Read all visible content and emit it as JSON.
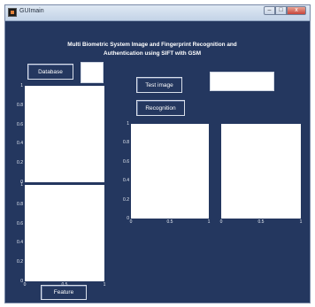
{
  "window": {
    "title": "GUImain"
  },
  "window_buttons": {
    "minimize": "–",
    "maximize": "□",
    "close": "x"
  },
  "heading": {
    "line1": "Multi Biometric System Image and Fingerprint Recognition and",
    "line2": "Authentication using SIFT with GSM"
  },
  "buttons": {
    "database": "Database",
    "test_image": "Test image",
    "recognition": "Recognition",
    "feature": "Feature"
  },
  "axes": {
    "left_top": {
      "yticks": [
        "1",
        "0.8",
        "0.6",
        "0.4",
        "0.2",
        "0"
      ],
      "xticks": []
    },
    "left_bottom": {
      "yticks": [
        "1",
        "0.8",
        "0.6",
        "0.4",
        "0.2",
        "0"
      ],
      "xticks": [
        "0",
        "0.5",
        "1"
      ]
    },
    "middle": {
      "yticks": [
        "1",
        "0.8",
        "0.6",
        "0.4",
        "0.2",
        "0"
      ],
      "xticks": [
        "0",
        "0.5",
        "1"
      ]
    },
    "right": {
      "yticks": [],
      "xticks": [
        "0",
        "0.5",
        "1"
      ]
    }
  },
  "colors": {
    "background": "#24375f",
    "button_border": "#d9dfea",
    "axes_fill": "#ffffff"
  }
}
